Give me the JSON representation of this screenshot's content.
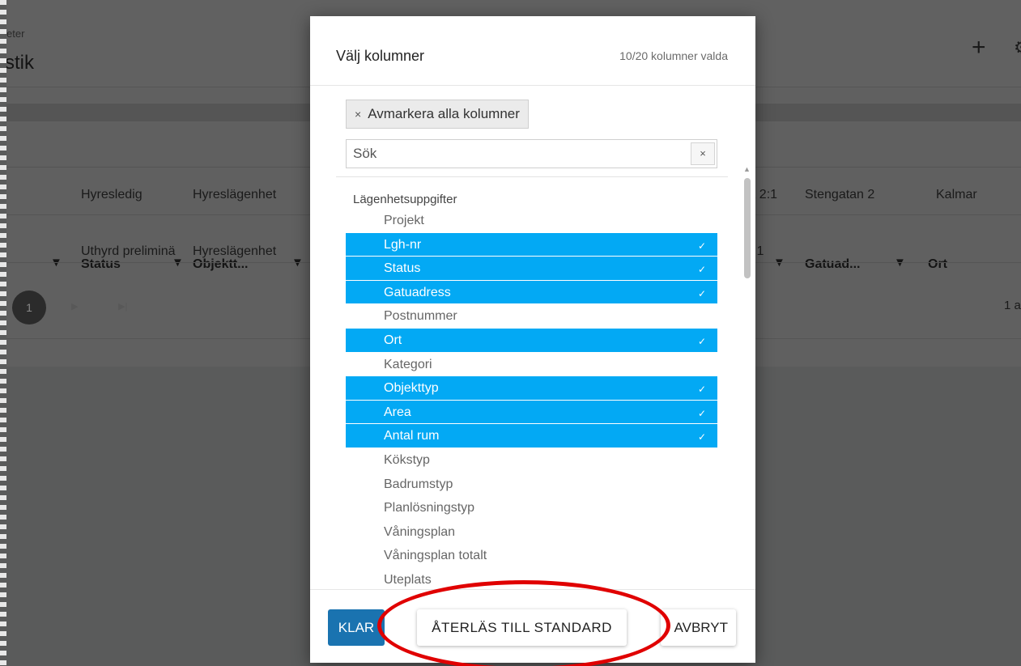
{
  "background": {
    "breadcrumb": "eter",
    "page_title": "stik",
    "add_icon": "plus-icon",
    "columns": [
      {
        "label": "Status",
        "filter": "filter-icon"
      },
      {
        "label": "Objektt...",
        "filter": "filter-icon"
      },
      {
        "label": "Gatuad...",
        "filter": "filter-icon"
      },
      {
        "label": "Ort",
        "filter": "filter-icon"
      }
    ],
    "rows": [
      {
        "status": "Hyresledig",
        "objekttyp": "Hyreslägenhet",
        "partial": "et 2:1",
        "gatuadress": "Stengatan 2",
        "ort": "Kalmar"
      },
      {
        "status": "Uthyrd preliminä",
        "objekttyp": "Hyreslägenhet",
        "partial": ":1",
        "gatuadress": "",
        "ort": ""
      }
    ],
    "pager": {
      "current_page": "1",
      "info": "1 a"
    }
  },
  "modal": {
    "title": "Välj kolumner",
    "selected_count": "10/20 kolumner valda",
    "deselect_all_label": "Avmarkera alla kolumner",
    "search": {
      "placeholder": "Sök",
      "value": "",
      "clear_label": "×"
    },
    "group_label": "Lägenhetsuppgifter",
    "columns": [
      {
        "label": "Projekt",
        "selected": false
      },
      {
        "label": "Lgh-nr",
        "selected": true
      },
      {
        "label": "Status",
        "selected": true
      },
      {
        "label": "Gatuadress",
        "selected": true
      },
      {
        "label": "Postnummer",
        "selected": false
      },
      {
        "label": "Ort",
        "selected": true
      },
      {
        "label": "Kategori",
        "selected": false
      },
      {
        "label": "Objekttyp",
        "selected": true
      },
      {
        "label": "Area",
        "selected": true
      },
      {
        "label": "Antal rum",
        "selected": true
      },
      {
        "label": "Kökstyp",
        "selected": false
      },
      {
        "label": "Badrumstyp",
        "selected": false
      },
      {
        "label": "Planlösningstyp",
        "selected": false
      },
      {
        "label": "Våningsplan",
        "selected": false
      },
      {
        "label": "Våningsplan totalt",
        "selected": false
      },
      {
        "label": "Uteplats",
        "selected": false
      }
    ],
    "buttons": {
      "done": "KLAR",
      "reset": "ÅTERLÄS TILL STANDARD",
      "cancel": "AVBRYT"
    }
  },
  "colors": {
    "selected_row": "#03a9f4",
    "primary_button": "#1a73b0",
    "highlight": "#e00000",
    "overlay": "#5a5b5b"
  }
}
